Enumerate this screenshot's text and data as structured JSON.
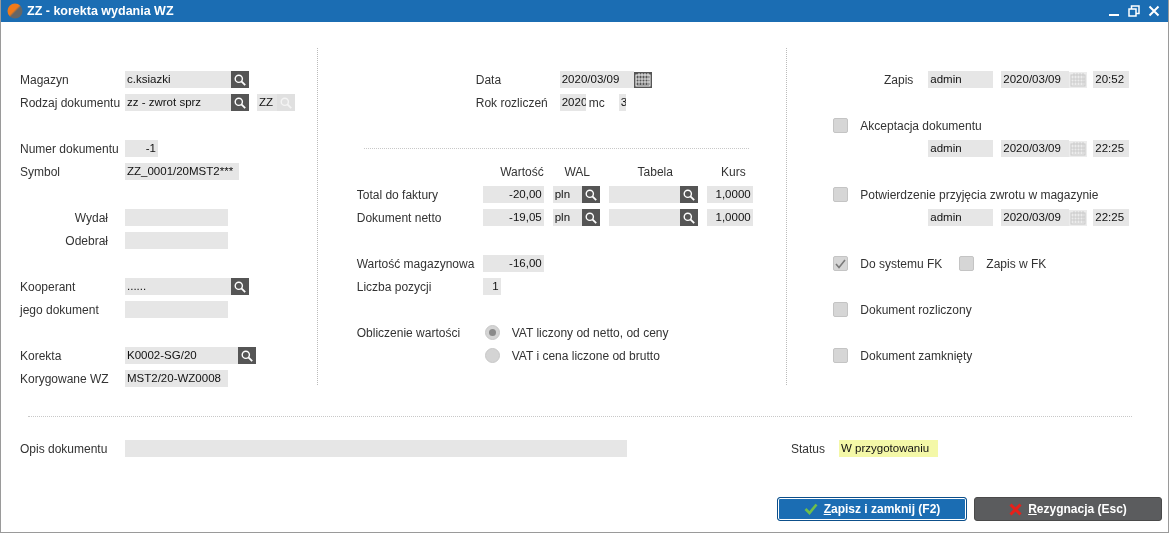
{
  "window": {
    "title": "ZZ - korekta wydania WZ"
  },
  "document": {
    "fields": [
      {
        "label": "Magazyn",
        "value": "c.ksiazki",
        "lookup": true
      },
      {
        "label": "Rodzaj dokumentu",
        "value": "zz - zwrot sprz",
        "lookup": true,
        "code": {
          "value": "ZZ",
          "lookup_disabled": true
        }
      },
      {
        "label": "Numer dokumentu",
        "value": "-1"
      },
      {
        "label": "Symbol",
        "value": "ZZ_0001/20MST2***"
      },
      {
        "label": "Wydał"
      },
      {
        "label": "Odebrał"
      },
      {
        "label": "Kooperant",
        "value": "......",
        "lookup": true
      },
      {
        "label": "jego dokument"
      },
      {
        "label": "Korekta",
        "value": "K0002-SG/20",
        "lookup": true
      },
      {
        "label": "Korygowane WZ",
        "value": "MST2/20-WZ0008"
      }
    ]
  },
  "dates": {
    "date": {
      "label": "Data",
      "value": "2020/03/09"
    },
    "period": {
      "label": "Rok rozliczeń",
      "year": "2020",
      "month_label": "mc",
      "month": "3"
    }
  },
  "values": {
    "columns": [
      "Wartość",
      "WAL",
      "Tabela",
      "Kurs"
    ],
    "rows": [
      {
        "label": "Total do faktury",
        "value": "-20,00",
        "currency": "pln",
        "rate": "1,0000"
      },
      {
        "label": "Dokument netto",
        "value": "-19,05",
        "currency": "pln",
        "rate": "1,0000"
      }
    ]
  },
  "stock_value": {
    "label": "Wartość magazynowa",
    "value": "-16,00"
  },
  "item_count": {
    "label": "Liczba pozycji",
    "value": "1"
  },
  "calculation": {
    "label": "Obliczenie wartości",
    "options": [
      {
        "label": "VAT liczony od netto, od ceny",
        "selected": true
      },
      {
        "label": "VAT i cena liczone od brutto",
        "selected": false
      }
    ]
  },
  "record": {
    "label": "Zapis",
    "user": "admin",
    "date": "2020/03/09",
    "time": "20:52"
  },
  "approvals": [
    {
      "label": "Akceptacja dokumentu",
      "checked": false,
      "user": "admin",
      "date": "2020/03/09",
      "time": "22:25"
    },
    {
      "label": "Potwierdzenie przyjęcia zwrotu w magazynie",
      "checked": false,
      "user": "admin",
      "date": "2020/03/09",
      "time": "22:25"
    }
  ],
  "flags": [
    {
      "items": [
        {
          "label": "Do systemu FK",
          "checked": true
        },
        {
          "label": "Zapis w FK",
          "checked": false
        }
      ]
    },
    {
      "items": [
        {
          "label": "Dokument rozliczony",
          "checked": false
        }
      ]
    },
    {
      "items": [
        {
          "label": "Dokument zamknięty",
          "checked": false
        }
      ]
    }
  ],
  "description": {
    "label": "Opis dokumentu"
  },
  "status": {
    "label": "Status",
    "value": "W przygotowaniu"
  },
  "buttons": [
    {
      "label": "Zapisz i zamknij (F2)",
      "kind": "save",
      "mnemonic_underlined": true
    },
    {
      "label": "Rezygnacja (Esc)",
      "kind": "cancel",
      "mnemonic_underlined": true
    }
  ]
}
